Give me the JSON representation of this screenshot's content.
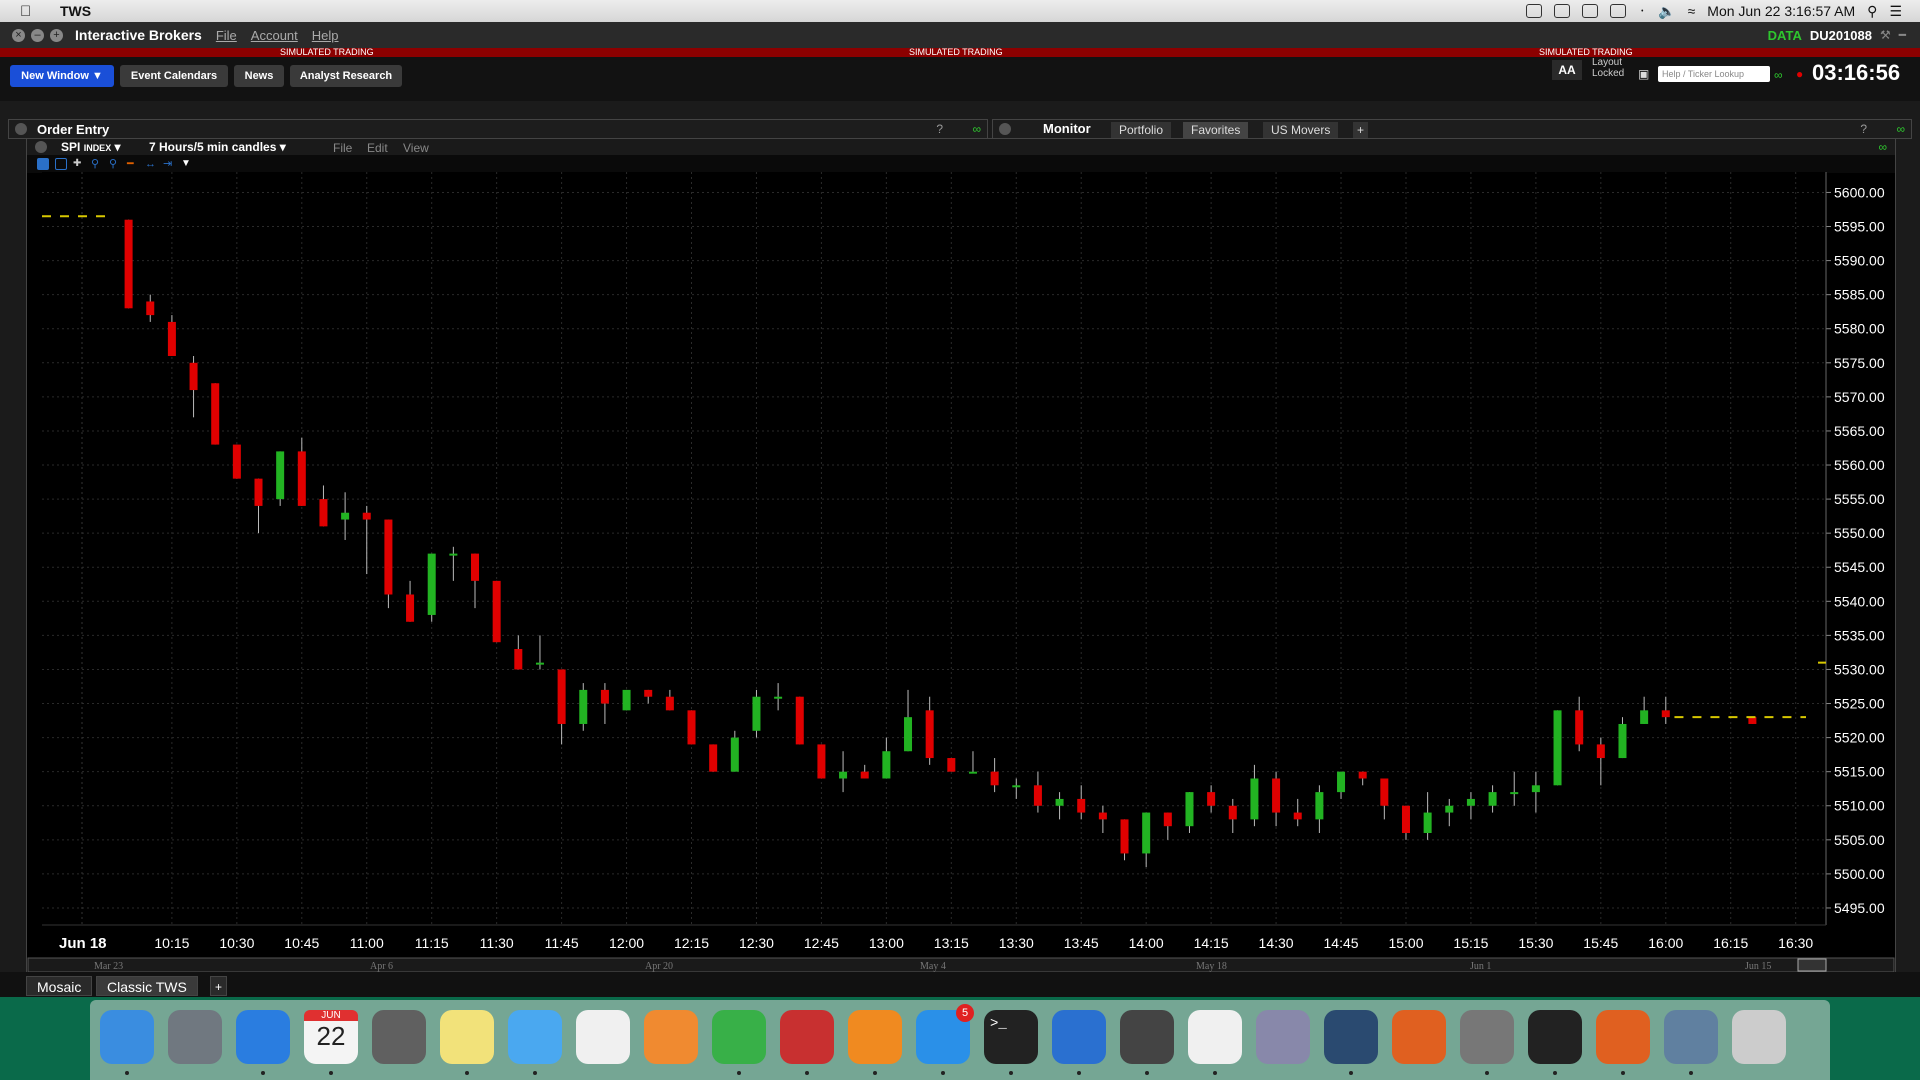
{
  "menubar": {
    "app_name": "TWS",
    "datetime": "Mon Jun 22  3:16:57 AM"
  },
  "window": {
    "brand": "Interactive Brokers",
    "menus": [
      "File",
      "Account",
      "Help"
    ],
    "data_label": "DATA",
    "account_id": "DU201088",
    "banner": [
      "SIMULATED TRADING",
      "SIMULATED TRADING",
      "SIMULATED TRADING"
    ]
  },
  "toolbar": {
    "new_window": "New Window",
    "buttons": [
      "Event Calendars",
      "News",
      "Analyst Research"
    ],
    "font_button": "AA",
    "layout_line1": "Layout",
    "layout_line2": "Locked",
    "ticker_placeholder": "Help / Ticker Lookup",
    "clock": "03:16:56"
  },
  "order_entry": {
    "title": "Order Entry"
  },
  "monitor": {
    "title": "Monitor",
    "tabs": [
      "Portfolio",
      "Favorites",
      "US Movers"
    ],
    "add_tab": "+"
  },
  "chart_window": {
    "symbol": "SPI",
    "symbol_type": "INDEX",
    "period": "7 Hours/5 min candles",
    "menus": [
      "File",
      "Edit",
      "View"
    ]
  },
  "bottom_tabs": [
    "Mosaic",
    "Classic TWS",
    "+"
  ],
  "dock": {
    "calendar_month": "JUN",
    "calendar_day": "22",
    "appstore_badge": "5",
    "icons": [
      "finder-icon",
      "launchpad-icon",
      "safari-icon",
      "calendar-icon",
      "calculator-icon",
      "notes-icon",
      "messages-icon",
      "textedit-icon",
      "pages-icon",
      "numbers-icon",
      "parallels-icon",
      "ibooks-icon",
      "appstore-icon",
      "terminal-icon",
      "teamviewer-icon",
      "dvd-icon",
      "java-icon",
      "network-icon",
      "sourcetree-icon",
      "matlab-icon",
      "preferences-icon",
      "activity-monitor-icon",
      "matlab2-icon",
      "preview-icon",
      "trash-icon"
    ]
  },
  "chart_data": {
    "type": "candlestick",
    "title": "",
    "y_ticks": [
      5600.0,
      5595.0,
      5590.0,
      5585.0,
      5580.0,
      5575.0,
      5570.0,
      5565.0,
      5560.0,
      5555.0,
      5550.0,
      5545.0,
      5540.0,
      5535.0,
      5530.0,
      5525.0,
      5520.0,
      5515.0,
      5510.0,
      5505.0,
      5500.0,
      5495.0
    ],
    "y_tick_labels": [
      "5600.00",
      "5595.00",
      "5590.00",
      "5585.00",
      "5580.00",
      "5575.00",
      "5570.00",
      "5565.00",
      "5560.00",
      "5555.00",
      "5550.00",
      "5545.00",
      "5540.00",
      "5535.00",
      "5530.00",
      "5525.00",
      "5520.00",
      "5515.00",
      "5510.00",
      "5505.00",
      "5500.00",
      "5495.00"
    ],
    "ylim": [
      5492.5,
      5603
    ],
    "x_start_label": "Jun 18",
    "x_ticks": [
      "10:15",
      "10:30",
      "10:45",
      "11:00",
      "11:15",
      "11:30",
      "11:45",
      "12:00",
      "12:15",
      "12:30",
      "12:45",
      "13:00",
      "13:15",
      "13:30",
      "13:45",
      "14:00",
      "14:15",
      "14:30",
      "14:45",
      "15:00",
      "15:15",
      "15:30",
      "15:45",
      "16:00",
      "16:15",
      "16:30"
    ],
    "x_tick_minutes": [
      615,
      630,
      645,
      660,
      675,
      690,
      705,
      720,
      735,
      750,
      765,
      780,
      795,
      810,
      825,
      840,
      855,
      870,
      885,
      900,
      915,
      930,
      945,
      960,
      975,
      990
    ],
    "x_range_minutes": [
      585,
      997
    ],
    "navigator_labels": [
      "Mar 23",
      "Apr 6",
      "Apr 20",
      "May 4",
      "May 18",
      "Jun 1",
      "Jun 15"
    ],
    "prior_close": 5596.5,
    "last_close": 5523,
    "last_marker": 5531,
    "colors": {
      "up": "#22b322",
      "down": "#e00000",
      "dash": "#d8c800",
      "axis_text": "#ffffff"
    },
    "candles": [
      {
        "t": 605,
        "o": 5596,
        "h": 5596,
        "l": 5583,
        "c": 5583
      },
      {
        "t": 610,
        "o": 5584,
        "h": 5585,
        "l": 5581,
        "c": 5582
      },
      {
        "t": 615,
        "o": 5581,
        "h": 5582,
        "l": 5576,
        "c": 5576
      },
      {
        "t": 620,
        "o": 5575,
        "h": 5576,
        "l": 5567,
        "c": 5571
      },
      {
        "t": 625,
        "o": 5572,
        "h": 5572,
        "l": 5563,
        "c": 5563
      },
      {
        "t": 630,
        "o": 5563,
        "h": 5563,
        "l": 5558,
        "c": 5558
      },
      {
        "t": 635,
        "o": 5558,
        "h": 5558,
        "l": 5550,
        "c": 5554
      },
      {
        "t": 640,
        "o": 5555,
        "h": 5562,
        "l": 5554,
        "c": 5562
      },
      {
        "t": 645,
        "o": 5562,
        "h": 5564,
        "l": 5554,
        "c": 5554
      },
      {
        "t": 650,
        "o": 5555,
        "h": 5557,
        "l": 5551,
        "c": 5551
      },
      {
        "t": 655,
        "o": 5552,
        "h": 5556,
        "l": 5549,
        "c": 5553
      },
      {
        "t": 660,
        "o": 5553,
        "h": 5554,
        "l": 5544,
        "c": 5552
      },
      {
        "t": 665,
        "o": 5552,
        "h": 5552,
        "l": 5539,
        "c": 5541
      },
      {
        "t": 670,
        "o": 5541,
        "h": 5543,
        "l": 5537,
        "c": 5537
      },
      {
        "t": 675,
        "o": 5538,
        "h": 5547,
        "l": 5537,
        "c": 5547
      },
      {
        "t": 680,
        "o": 5547,
        "h": 5548,
        "l": 5543,
        "c": 5547
      },
      {
        "t": 685,
        "o": 5547,
        "h": 5547,
        "l": 5539,
        "c": 5543
      },
      {
        "t": 690,
        "o": 5543,
        "h": 5543,
        "l": 5534,
        "c": 5534
      },
      {
        "t": 695,
        "o": 5533,
        "h": 5535,
        "l": 5530,
        "c": 5530
      },
      {
        "t": 700,
        "o": 5531,
        "h": 5535,
        "l": 5530,
        "c": 5531
      },
      {
        "t": 705,
        "o": 5530,
        "h": 5530,
        "l": 5519,
        "c": 5522
      },
      {
        "t": 710,
        "o": 5522,
        "h": 5528,
        "l": 5521,
        "c": 5527
      },
      {
        "t": 715,
        "o": 5527,
        "h": 5528,
        "l": 5522,
        "c": 5525
      },
      {
        "t": 720,
        "o": 5524,
        "h": 5527,
        "l": 5524,
        "c": 5527
      },
      {
        "t": 725,
        "o": 5527,
        "h": 5527,
        "l": 5525,
        "c": 5526
      },
      {
        "t": 730,
        "o": 5526,
        "h": 5527,
        "l": 5524,
        "c": 5524
      },
      {
        "t": 735,
        "o": 5524,
        "h": 5524,
        "l": 5519,
        "c": 5519
      },
      {
        "t": 740,
        "o": 5519,
        "h": 5519,
        "l": 5515,
        "c": 5515
      },
      {
        "t": 745,
        "o": 5515,
        "h": 5521,
        "l": 5515,
        "c": 5520
      },
      {
        "t": 750,
        "o": 5521,
        "h": 5527,
        "l": 5520,
        "c": 5526
      },
      {
        "t": 755,
        "o": 5526,
        "h": 5528,
        "l": 5524,
        "c": 5526
      },
      {
        "t": 760,
        "o": 5526,
        "h": 5526,
        "l": 5519,
        "c": 5519
      },
      {
        "t": 765,
        "o": 5519,
        "h": 5519,
        "l": 5514,
        "c": 5514
      },
      {
        "t": 770,
        "o": 5514,
        "h": 5518,
        "l": 5512,
        "c": 5515
      },
      {
        "t": 775,
        "o": 5515,
        "h": 5516,
        "l": 5514,
        "c": 5514
      },
      {
        "t": 780,
        "o": 5514,
        "h": 5520,
        "l": 5514,
        "c": 5518
      },
      {
        "t": 785,
        "o": 5518,
        "h": 5527,
        "l": 5518,
        "c": 5523
      },
      {
        "t": 790,
        "o": 5524,
        "h": 5526,
        "l": 5516,
        "c": 5517
      },
      {
        "t": 795,
        "o": 5517,
        "h": 5517,
        "l": 5515,
        "c": 5515
      },
      {
        "t": 800,
        "o": 5515,
        "h": 5518,
        "l": 5515,
        "c": 5515
      },
      {
        "t": 805,
        "o": 5515,
        "h": 5517,
        "l": 5512,
        "c": 5513
      },
      {
        "t": 810,
        "o": 5513,
        "h": 5514,
        "l": 5511,
        "c": 5513
      },
      {
        "t": 815,
        "o": 5513,
        "h": 5515,
        "l": 5509,
        "c": 5510
      },
      {
        "t": 820,
        "o": 5510,
        "h": 5512,
        "l": 5508,
        "c": 5511
      },
      {
        "t": 825,
        "o": 5511,
        "h": 5513,
        "l": 5508,
        "c": 5509
      },
      {
        "t": 830,
        "o": 5509,
        "h": 5510,
        "l": 5506,
        "c": 5508
      },
      {
        "t": 835,
        "o": 5508,
        "h": 5508,
        "l": 5502,
        "c": 5503
      },
      {
        "t": 840,
        "o": 5503,
        "h": 5509,
        "l": 5501,
        "c": 5509
      },
      {
        "t": 845,
        "o": 5509,
        "h": 5509,
        "l": 5505,
        "c": 5507
      },
      {
        "t": 850,
        "o": 5507,
        "h": 5512,
        "l": 5506,
        "c": 5512
      },
      {
        "t": 855,
        "o": 5512,
        "h": 5513,
        "l": 5509,
        "c": 5510
      },
      {
        "t": 860,
        "o": 5510,
        "h": 5511,
        "l": 5506,
        "c": 5508
      },
      {
        "t": 865,
        "o": 5508,
        "h": 5516,
        "l": 5507,
        "c": 5514
      },
      {
        "t": 870,
        "o": 5514,
        "h": 5515,
        "l": 5507,
        "c": 5509
      },
      {
        "t": 875,
        "o": 5509,
        "h": 5511,
        "l": 5507,
        "c": 5508
      },
      {
        "t": 880,
        "o": 5508,
        "h": 5513,
        "l": 5506,
        "c": 5512
      },
      {
        "t": 885,
        "o": 5512,
        "h": 5515,
        "l": 5511,
        "c": 5515
      },
      {
        "t": 890,
        "o": 5515,
        "h": 5515,
        "l": 5513,
        "c": 5514
      },
      {
        "t": 895,
        "o": 5514,
        "h": 5514,
        "l": 5508,
        "c": 5510
      },
      {
        "t": 900,
        "o": 5510,
        "h": 5510,
        "l": 5505,
        "c": 5506
      },
      {
        "t": 905,
        "o": 5506,
        "h": 5512,
        "l": 5505,
        "c": 5509
      },
      {
        "t": 910,
        "o": 5509,
        "h": 5511,
        "l": 5507,
        "c": 5510
      },
      {
        "t": 915,
        "o": 5510,
        "h": 5512,
        "l": 5508,
        "c": 5511
      },
      {
        "t": 920,
        "o": 5510,
        "h": 5513,
        "l": 5509,
        "c": 5512
      },
      {
        "t": 925,
        "o": 5512,
        "h": 5515,
        "l": 5510,
        "c": 5512
      },
      {
        "t": 930,
        "o": 5512,
        "h": 5515,
        "l": 5509,
        "c": 5513
      },
      {
        "t": 935,
        "o": 5513,
        "h": 5524,
        "l": 5513,
        "c": 5524
      },
      {
        "t": 940,
        "o": 5524,
        "h": 5526,
        "l": 5518,
        "c": 5519
      },
      {
        "t": 945,
        "o": 5519,
        "h": 5520,
        "l": 5513,
        "c": 5517
      },
      {
        "t": 950,
        "o": 5517,
        "h": 5523,
        "l": 5517,
        "c": 5522
      },
      {
        "t": 955,
        "o": 5522,
        "h": 5526,
        "l": 5522,
        "c": 5524
      },
      {
        "t": 960,
        "o": 5524,
        "h": 5526,
        "l": 5522,
        "c": 5523
      },
      {
        "t": 980,
        "o": 5523,
        "h": 5523,
        "l": 5522,
        "c": 5522
      }
    ]
  }
}
